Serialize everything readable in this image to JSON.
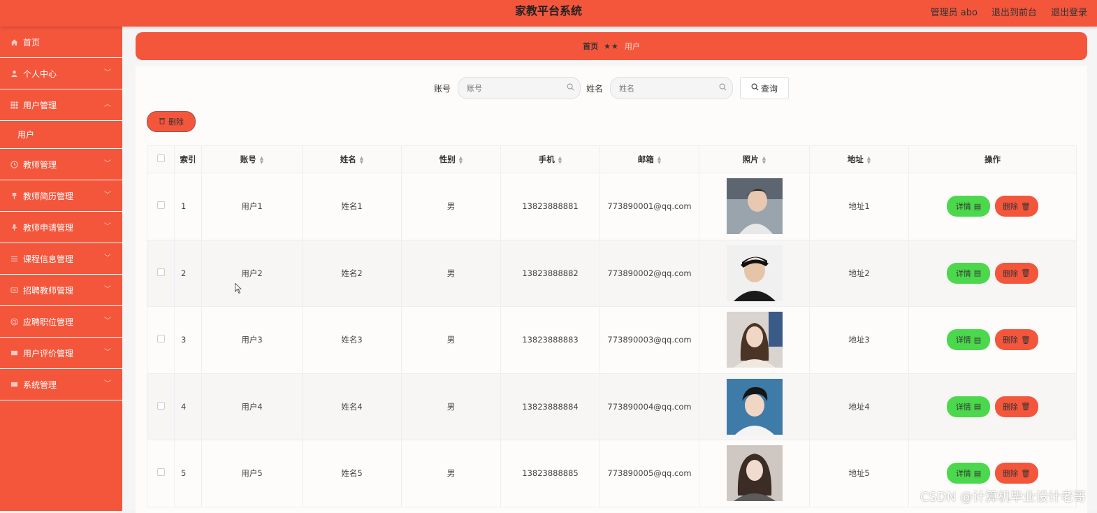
{
  "header": {
    "title": "家教平台系统",
    "admin_label": "管理员 abo",
    "front_label": "退出到前台",
    "logout_label": "退出登录"
  },
  "sidebar": {
    "items": [
      {
        "label": "首页",
        "icon": "home-icon",
        "has_chevron": false
      },
      {
        "label": "个人中心",
        "icon": "user-icon",
        "has_chevron": true
      },
      {
        "label": "用户管理",
        "icon": "grid-icon",
        "has_chevron": true,
        "expanded": true
      },
      {
        "label": "教师管理",
        "icon": "clock-icon",
        "has_chevron": true
      },
      {
        "label": "教师简历管理",
        "icon": "pin-icon",
        "has_chevron": true
      },
      {
        "label": "教师申请管理",
        "icon": "mic-icon",
        "has_chevron": true
      },
      {
        "label": "课程信息管理",
        "icon": "list-icon",
        "has_chevron": true
      },
      {
        "label": "招聘教师管理",
        "icon": "message-icon",
        "has_chevron": true
      },
      {
        "label": "应聘职位管理",
        "icon": "target-icon",
        "has_chevron": true
      },
      {
        "label": "用户评价管理",
        "icon": "chat-icon",
        "has_chevron": true
      },
      {
        "label": "系统管理",
        "icon": "chat-icon",
        "has_chevron": true
      }
    ],
    "subitem": "用户"
  },
  "breadcrumb": {
    "home": "首页",
    "separator": "★★",
    "current": "用户"
  },
  "search": {
    "account_label": "账号",
    "account_placeholder": "账号",
    "name_label": "姓名",
    "name_placeholder": "姓名",
    "query_label": "查询"
  },
  "toolbar": {
    "delete_label": "删除"
  },
  "table": {
    "headers": [
      "索引",
      "账号",
      "姓名",
      "性别",
      "手机",
      "邮箱",
      "照片",
      "地址",
      "操作"
    ],
    "rows": [
      {
        "index": "1",
        "account": "用户1",
        "name": "姓名1",
        "gender": "男",
        "phone": "13823888881",
        "email": "773890001@qq.com",
        "address": "地址1"
      },
      {
        "index": "2",
        "account": "用户2",
        "name": "姓名2",
        "gender": "男",
        "phone": "13823888882",
        "email": "773890002@qq.com",
        "address": "地址2"
      },
      {
        "index": "3",
        "account": "用户3",
        "name": "姓名3",
        "gender": "男",
        "phone": "13823888883",
        "email": "773890003@qq.com",
        "address": "地址3"
      },
      {
        "index": "4",
        "account": "用户4",
        "name": "姓名4",
        "gender": "男",
        "phone": "13823888884",
        "email": "773890004@qq.com",
        "address": "地址4"
      },
      {
        "index": "5",
        "account": "用户5",
        "name": "姓名5",
        "gender": "男",
        "phone": "13823888885",
        "email": "773890005@qq.com",
        "address": "地址5"
      }
    ],
    "detail_label": "详情",
    "delete_label": "删除"
  },
  "watermark": "CSDN @计算机毕业设计老哥",
  "colors": {
    "primary": "#f4563c",
    "success": "#4cd84c",
    "border": "#ebeef5"
  }
}
